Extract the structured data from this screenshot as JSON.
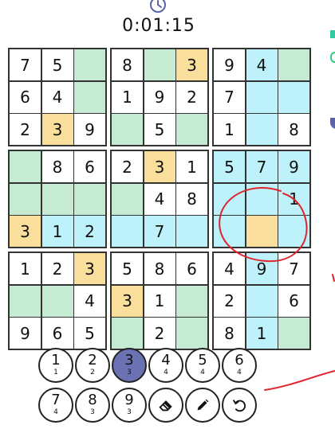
{
  "timer": "0:01:15",
  "boxes": [
    [
      {
        "v": "7",
        "c": "w"
      },
      {
        "v": "5",
        "c": "w"
      },
      {
        "v": "",
        "c": "g"
      },
      {
        "v": "6",
        "c": "w"
      },
      {
        "v": "4",
        "c": "w"
      },
      {
        "v": "",
        "c": "g"
      },
      {
        "v": "2",
        "c": "w"
      },
      {
        "v": "3",
        "c": "y"
      },
      {
        "v": "9",
        "c": "w"
      }
    ],
    [
      {
        "v": "8",
        "c": "w"
      },
      {
        "v": "",
        "c": "g"
      },
      {
        "v": "3",
        "c": "y"
      },
      {
        "v": "1",
        "c": "w"
      },
      {
        "v": "9",
        "c": "w"
      },
      {
        "v": "2",
        "c": "w"
      },
      {
        "v": "",
        "c": "g"
      },
      {
        "v": "5",
        "c": "w"
      },
      {
        "v": "",
        "c": "g"
      }
    ],
    [
      {
        "v": "9",
        "c": "w"
      },
      {
        "v": "4",
        "c": "b"
      },
      {
        "v": "",
        "c": "g"
      },
      {
        "v": "7",
        "c": "w"
      },
      {
        "v": "",
        "c": "b"
      },
      {
        "v": "",
        "c": "b"
      },
      {
        "v": "1",
        "c": "w"
      },
      {
        "v": "",
        "c": "b"
      },
      {
        "v": "8",
        "c": "w"
      }
    ],
    [
      {
        "v": "",
        "c": "g"
      },
      {
        "v": "8",
        "c": "w"
      },
      {
        "v": "6",
        "c": "w"
      },
      {
        "v": "",
        "c": "g"
      },
      {
        "v": "",
        "c": "g"
      },
      {
        "v": "",
        "c": "g"
      },
      {
        "v": "3",
        "c": "y"
      },
      {
        "v": "1",
        "c": "b"
      },
      {
        "v": "2",
        "c": "b"
      }
    ],
    [
      {
        "v": "2",
        "c": "w"
      },
      {
        "v": "3",
        "c": "y"
      },
      {
        "v": "1",
        "c": "w"
      },
      {
        "v": "",
        "c": "g"
      },
      {
        "v": "4",
        "c": "w"
      },
      {
        "v": "8",
        "c": "w"
      },
      {
        "v": "",
        "c": "b"
      },
      {
        "v": "7",
        "c": "b"
      },
      {
        "v": "",
        "c": "b"
      }
    ],
    [
      {
        "v": "5",
        "c": "b"
      },
      {
        "v": "7",
        "c": "b"
      },
      {
        "v": "9",
        "c": "b"
      },
      {
        "v": "",
        "c": "b"
      },
      {
        "v": "",
        "c": "b"
      },
      {
        "v": "1",
        "c": "b"
      },
      {
        "v": "",
        "c": "b"
      },
      {
        "v": "",
        "c": "y"
      },
      {
        "v": "",
        "c": "b"
      }
    ],
    [
      {
        "v": "1",
        "c": "w"
      },
      {
        "v": "2",
        "c": "w"
      },
      {
        "v": "3",
        "c": "y"
      },
      {
        "v": "",
        "c": "g"
      },
      {
        "v": "",
        "c": "g"
      },
      {
        "v": "4",
        "c": "w"
      },
      {
        "v": "9",
        "c": "w"
      },
      {
        "v": "6",
        "c": "w"
      },
      {
        "v": "5",
        "c": "w"
      }
    ],
    [
      {
        "v": "5",
        "c": "w"
      },
      {
        "v": "8",
        "c": "w"
      },
      {
        "v": "6",
        "c": "w"
      },
      {
        "v": "3",
        "c": "y"
      },
      {
        "v": "1",
        "c": "w"
      },
      {
        "v": "",
        "c": "g"
      },
      {
        "v": "",
        "c": "g"
      },
      {
        "v": "2",
        "c": "w"
      },
      {
        "v": "",
        "c": "g"
      }
    ],
    [
      {
        "v": "4",
        "c": "w"
      },
      {
        "v": "9",
        "c": "b"
      },
      {
        "v": "7",
        "c": "w"
      },
      {
        "v": "2",
        "c": "w"
      },
      {
        "v": "",
        "c": "b"
      },
      {
        "v": "6",
        "c": "w"
      },
      {
        "v": "8",
        "c": "w"
      },
      {
        "v": "1",
        "c": "b"
      },
      {
        "v": "",
        "c": "g"
      }
    ]
  ],
  "keypad": [
    {
      "num": "1",
      "count": "1"
    },
    {
      "num": "2",
      "count": "2"
    },
    {
      "num": "3",
      "count": "3",
      "selected": true
    },
    {
      "num": "4",
      "count": "4"
    },
    {
      "num": "5",
      "count": "4"
    },
    {
      "num": "6",
      "count": "4"
    },
    {
      "num": "7",
      "count": "4"
    },
    {
      "num": "8",
      "count": "3"
    },
    {
      "num": "9",
      "count": "3"
    }
  ],
  "tools": [
    "eraser-icon",
    "pencil-icon",
    "undo-icon"
  ],
  "colors": {
    "green": "#c5ecd2",
    "yellow": "#f9df9b",
    "blue": "#bdf2fb",
    "selected_key": "#6a72b3",
    "annotation": "#e0242c"
  }
}
